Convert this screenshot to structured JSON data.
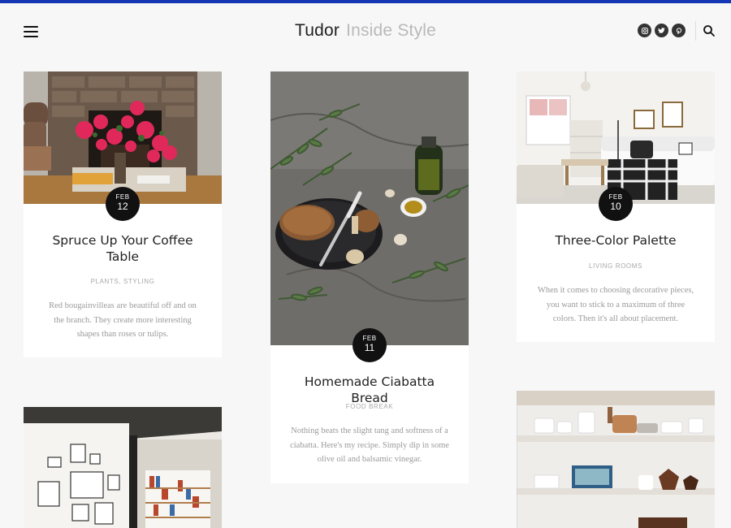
{
  "brand": {
    "name": "Tudor",
    "tagline": "Inside Style"
  },
  "header": {
    "social": [
      {
        "name": "instagram-icon"
      },
      {
        "name": "twitter-icon"
      },
      {
        "name": "pinterest-icon"
      }
    ]
  },
  "posts": [
    {
      "month": "FEB",
      "day": "12",
      "title": "Spruce Up Your Coffee Table",
      "categories": "PLANTS, STYLING",
      "excerpt": "Red bougainvilleas are beautiful off and on the branch. They create more interesting shapes than roses or tulips."
    },
    {
      "month": "FEB",
      "day": "11",
      "title": "Homemade Ciabatta Bread",
      "categories": "FOOD BREAK",
      "excerpt": "Nothing beats the slight tang and softness of a ciabatta. Here's my recipe. Simply dip in some olive oil and balsamic vinegar."
    },
    {
      "month": "FEB",
      "day": "10",
      "title": "Three-Color Palette",
      "categories": "LIVING ROOMS",
      "excerpt": "When it comes to choosing decorative pieces, you want to stick to a maximum of three colors. Then it's all about placement."
    }
  ],
  "colors": {
    "accent_bar": "#1537b5",
    "badge": "#111111",
    "background": "#f7f7f7"
  }
}
